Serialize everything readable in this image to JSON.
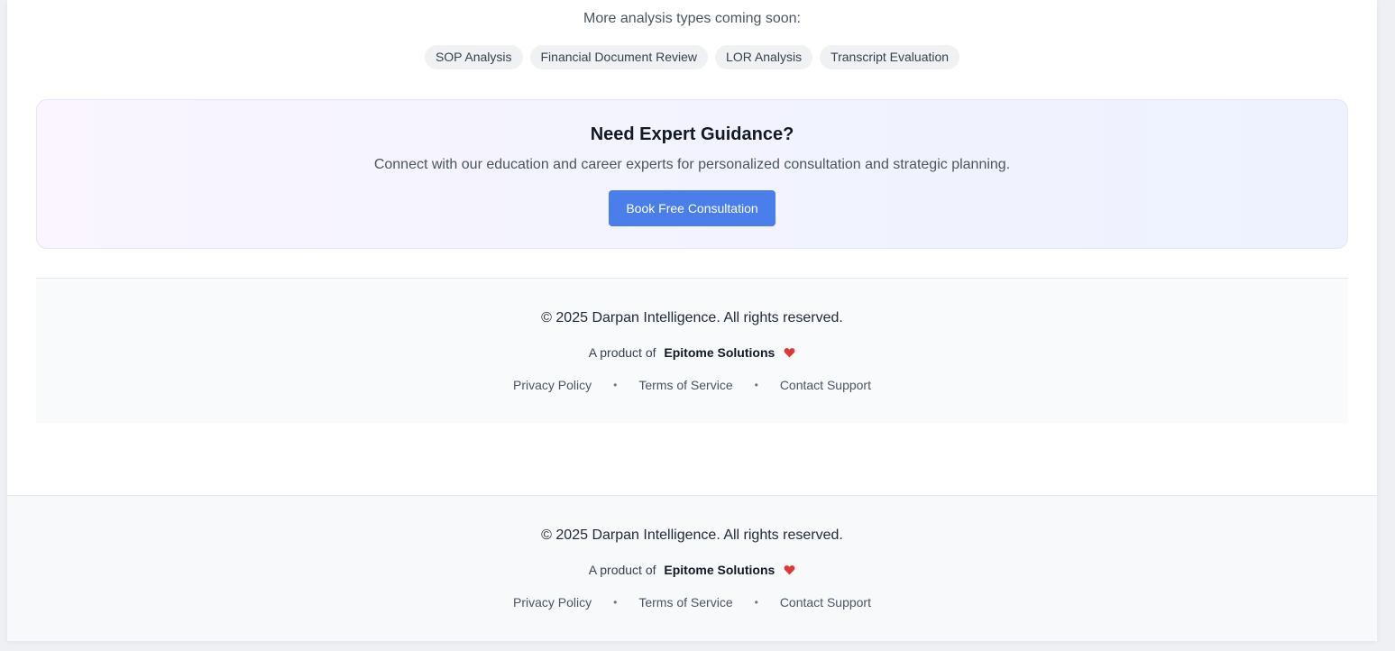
{
  "analysis": {
    "coming_soon": "More analysis types coming soon:",
    "chips": [
      "SOP Analysis",
      "Financial Document Review",
      "LOR Analysis",
      "Transcript Evaluation"
    ]
  },
  "cta": {
    "title": "Need Expert Guidance?",
    "description": "Connect with our education and career experts for personalized consultation and strategic planning.",
    "button_label": "Book Free Consultation"
  },
  "footer": {
    "copyright": "© 2025 Darpan Intelligence. All rights reserved.",
    "product_prefix": "A product of",
    "company": "Epitome Solutions",
    "links": [
      "Privacy Policy",
      "Terms of Service",
      "Contact Support"
    ],
    "separator": "•"
  },
  "colors": {
    "accent": "#4a7eeb",
    "heart": "#dc3a3a"
  }
}
